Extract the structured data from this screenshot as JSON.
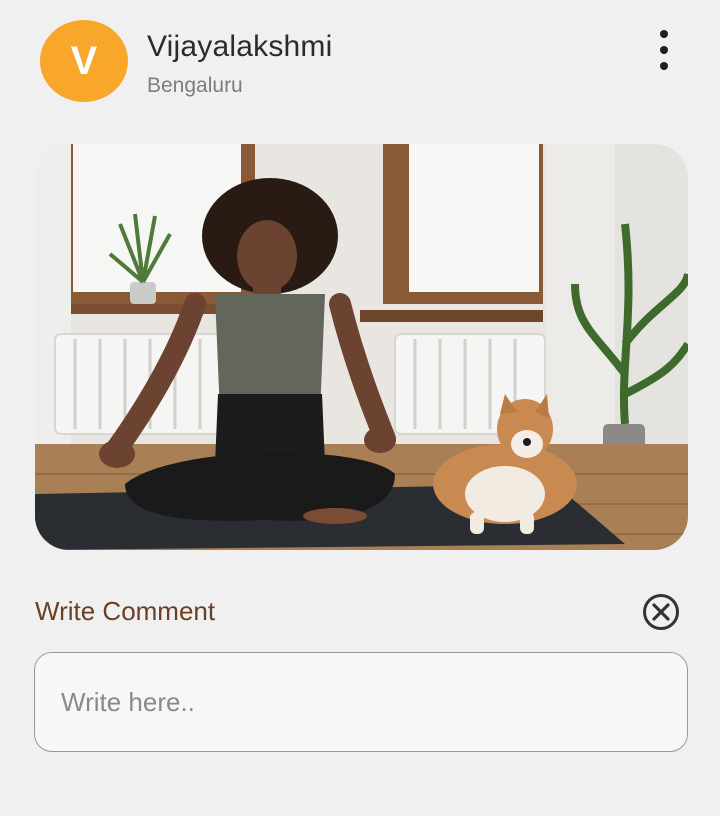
{
  "post": {
    "author": {
      "initial": "V",
      "name": "Vijayalakshmi",
      "location": "Bengaluru",
      "avatar_color": "#f9a72b"
    },
    "menu_icon": "more-vertical-icon",
    "image_subject": "woman meditating on yoga mat with shiba inu dog"
  },
  "comment": {
    "title": "Write Comment",
    "close_icon": "close-circle-icon",
    "placeholder": "Write here..",
    "value": ""
  },
  "colors": {
    "background": "#f0f0f0",
    "accent_brown": "#6b3f25",
    "avatar": "#f9a72b"
  }
}
